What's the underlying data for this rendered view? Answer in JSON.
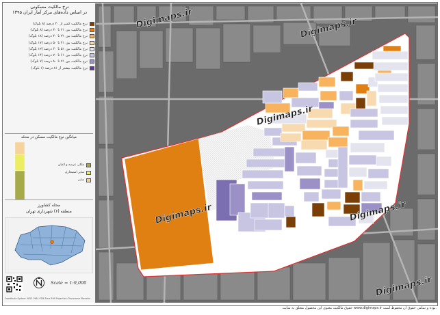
{
  "panel": {
    "title_line1": "نرخ مالکیت مسکونی",
    "title_line2": "در اساس داده‌های مرکز آمار ایران ۱۳۹۵",
    "legend": [
      {
        "label": "نرخ مالکیت کمتر از ۲۰ درصد (۸ بلوک)",
        "color": "#7a3f06"
      },
      {
        "label": "نرخ مالکیت بین ۲۱ تا ۳۰ درصد (۸ بلوک)",
        "color": "#e07f12"
      },
      {
        "label": "نرخ مالکیت بین ۳۱ تا ۴۰ درصد (۱۸ بلوک)",
        "color": "#f7b35e"
      },
      {
        "label": "نرخ مالکیت بین ۴۱ تا ۵۰ درصد (۱۷ بلوک)",
        "color": "#f8dab0"
      },
      {
        "label": "نرخ مالکیت بین ۵۱ تا ۶۰ درصد (۱۳ بلوک)",
        "color": "#e4e4ef"
      },
      {
        "label": "نرخ مالکیت بین ۶۱ تا ۷۰ درصد (۱۴ بلوک)",
        "color": "#c7c5e2"
      },
      {
        "label": "نرخ مالکیت بین ۷۱ تا ۸۰ درصد (۷ بلوک)",
        "color": "#9b91c6"
      },
      {
        "label": "نرخ مالکیت بیشتر از ۸۱ درصد (۱ بلوک)",
        "color": "#5b3d8f"
      }
    ],
    "chart_title": "میانگین نوع مالکیت مسکن در محله",
    "chart_legend": [
      {
        "label": "ملکی عرصه و اعیان",
        "color": "#a7aa4a"
      },
      {
        "label": "سایر استیجاری",
        "color": "#eded63"
      },
      {
        "label": "سایر",
        "color": "#f5d39a"
      }
    ],
    "chart_ticks": [
      "",
      "",
      "",
      ""
    ],
    "location_line1": "محله کشاورز",
    "location_line2": "منطقه (۶) شهرداری تهران",
    "scale": "Scale = 1:9,000",
    "coord_system": "Coordinate System: WGS 1984 UTM Zone 39N   Projection: Transverse Mercator"
  },
  "map": {
    "watermarks": [
      "Digimaps.ir",
      "Digimaps.ir",
      "Digimaps.ir",
      "Digimaps.ir",
      "Digimaps.ir",
      "Digimaps.ir"
    ],
    "boundary_color": "#e03030"
  },
  "credit": "حقوق مالکیت معنوی این محصول متعلق به سایت www.digimaps.ir بوده و تمامی حقوق آن محفوظ است."
}
